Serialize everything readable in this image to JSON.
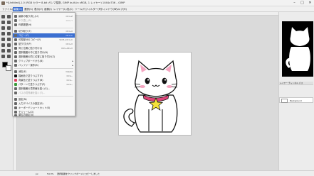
{
  "window": {
    "title": "*[Untitled]-1.0 (RGB カラー 8-bit ガンマ整数, GIMP built-in sRGB, 1 レイヤー) 1044x736 – GIMP",
    "minimize": "–",
    "maximize": "□",
    "close": "✕"
  },
  "menubar": {
    "items": [
      "ファイル(F)",
      "編集(E)",
      "選択(S)",
      "表示(V)",
      "画像(I)",
      "レイヤー(L)",
      "色(C)",
      "ツール(T)",
      "フィルター(R)",
      "ウィンドウ(W)",
      "ヘルプ(H)"
    ]
  },
  "edit_menu": {
    "items": [
      {
        "label": "最新の取り消し(U)",
        "shortcut": "Ctrl+Z",
        "disabled": false,
        "highlight": false
      },
      {
        "label": "やり直し(R)",
        "shortcut": "Ctrl+Y",
        "disabled": true,
        "highlight": false
      },
      {
        "label": "作業履歴(H)",
        "shortcut": "",
        "disabled": false,
        "highlight": false
      },
      {
        "label": "切り取り(T)",
        "shortcut": "Ctrl+X",
        "disabled": false,
        "highlight": false
      },
      {
        "label": "コピー(C)",
        "shortcut": "Ctrl+C",
        "disabled": false,
        "highlight": true
      },
      {
        "label": "可視部分のコピー(V)",
        "shortcut": "Shift+Ctrl+C",
        "disabled": false,
        "highlight": false
      },
      {
        "label": "貼り付け(P)",
        "shortcut": "Ctrl+V",
        "disabled": false,
        "highlight": false
      },
      {
        "label": "同じ位置に貼り付け(I)",
        "shortcut": "Ctrl+Alt+V",
        "disabled": false,
        "highlight": false
      },
      {
        "label": "選択範囲の中に貼り付け(N)",
        "shortcut": "",
        "disabled": false,
        "highlight": false
      },
      {
        "label": "選択範囲の同じ位置に貼り付け(Z)",
        "shortcut": "",
        "disabled": false,
        "highlight": false
      },
      {
        "label": "クリップボードから(B)",
        "shortcut": "",
        "disabled": false,
        "highlight": false,
        "submenu": true
      },
      {
        "label": "バッファー操作(B)",
        "shortcut": "",
        "disabled": false,
        "highlight": false,
        "submenu": true
      },
      {
        "label": "消去(E)",
        "shortcut": "Delete",
        "disabled": false,
        "highlight": false
      },
      {
        "label": "描画色で塗りつぶす(F)",
        "shortcut": "Ctrl+,",
        "disabled": false,
        "highlight": false
      },
      {
        "label": "背景色で塗りつぶす(B)",
        "shortcut": "Ctrl+.",
        "disabled": false,
        "highlight": false
      },
      {
        "label": "パターンで塗りつぶす(P)",
        "shortcut": "Ctrl+;",
        "disabled": false,
        "highlight": false
      },
      {
        "label": "選択範囲の境界線を描く(S)...",
        "shortcut": "",
        "disabled": false,
        "highlight": false
      },
      {
        "label": "パスの境界線を描く(T)...",
        "shortcut": "",
        "disabled": true,
        "highlight": false
      },
      {
        "label": "設定(N)",
        "shortcut": "",
        "disabled": false,
        "highlight": false
      },
      {
        "label": "入力デバイスの設定(D)",
        "shortcut": "",
        "disabled": false,
        "highlight": false
      },
      {
        "label": "キーボードショートカット(K)",
        "shortcut": "",
        "disabled": false,
        "highlight": false
      },
      {
        "label": "モジュール(O)",
        "shortcut": "",
        "disabled": false,
        "highlight": false
      },
      {
        "label": "単位の設定(U)",
        "shortcut": "",
        "disabled": false,
        "highlight": false
      }
    ]
  },
  "layers_panel": {
    "tabs": "レイヤー チャンネル パス",
    "layer_name": "Background"
  },
  "statusbar": {
    "unit": "px",
    "zoom": "54.3%",
    "message": "選択範囲をクリップボードにコピーしました"
  },
  "colors": {
    "menu_highlight": "#3b6fd1",
    "cat_collar": "#e0457b",
    "cat_star": "#f4e23a",
    "cat_cheek": "#f4a6c1"
  }
}
